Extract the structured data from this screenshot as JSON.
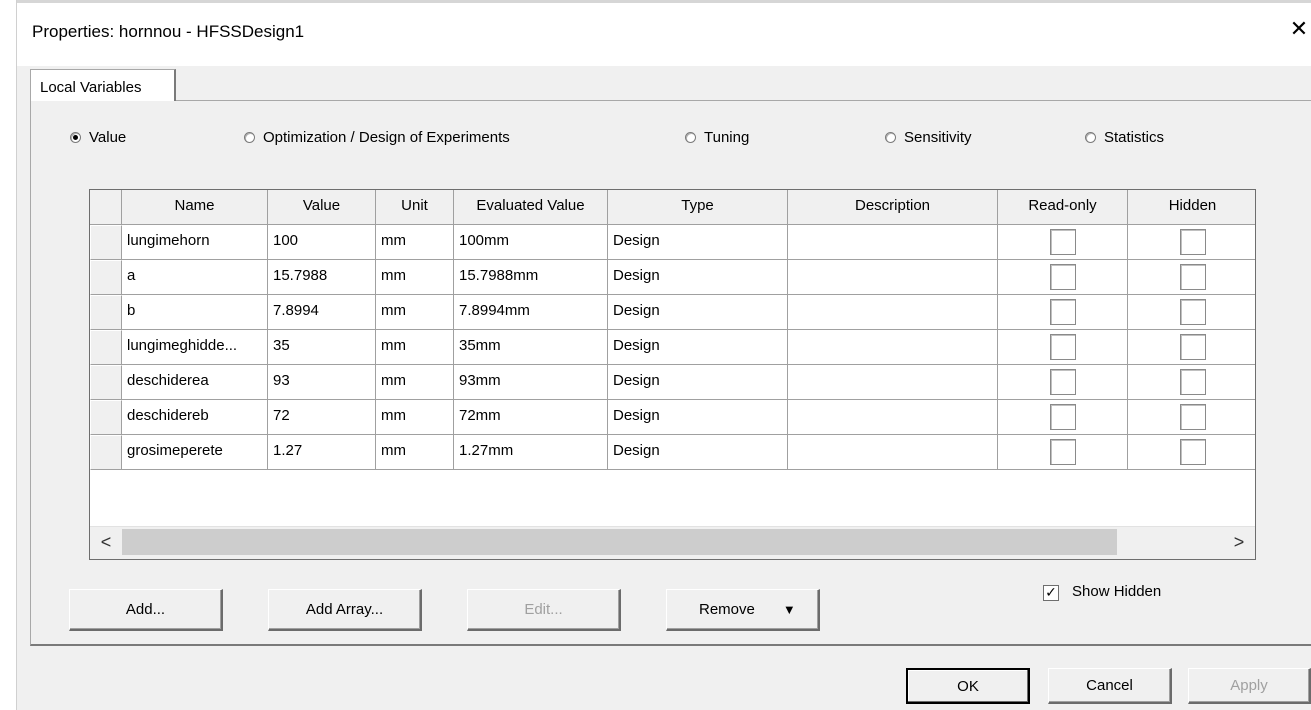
{
  "window": {
    "title": "Properties: hornnou - HFSSDesign1",
    "close_glyph": "✕"
  },
  "tab": {
    "label": "Local Variables"
  },
  "modes": [
    {
      "label": "Value",
      "checked": true
    },
    {
      "label": "Optimization / Design of Experiments",
      "checked": false
    },
    {
      "label": "Tuning",
      "checked": false
    },
    {
      "label": "Sensitivity",
      "checked": false
    },
    {
      "label": "Statistics",
      "checked": false
    }
  ],
  "table": {
    "columns": [
      "Name",
      "Value",
      "Unit",
      "Evaluated Value",
      "Type",
      "Description",
      "Read-only",
      "Hidden"
    ],
    "rows": [
      {
        "name": "lungimehorn",
        "value": "100",
        "unit": "mm",
        "evaluated": "100mm",
        "type": "Design",
        "description": "",
        "read_only": false,
        "hidden": false
      },
      {
        "name": "a",
        "value": "15.7988",
        "unit": "mm",
        "evaluated": "15.7988mm",
        "type": "Design",
        "description": "",
        "read_only": false,
        "hidden": false
      },
      {
        "name": "b",
        "value": "7.8994",
        "unit": "mm",
        "evaluated": "7.8994mm",
        "type": "Design",
        "description": "",
        "read_only": false,
        "hidden": false
      },
      {
        "name": "lungimeghidde...",
        "value": "35",
        "unit": "mm",
        "evaluated": "35mm",
        "type": "Design",
        "description": "",
        "read_only": false,
        "hidden": false
      },
      {
        "name": "deschiderea",
        "value": "93",
        "unit": "mm",
        "evaluated": "93mm",
        "type": "Design",
        "description": "",
        "read_only": false,
        "hidden": false
      },
      {
        "name": "deschidereb",
        "value": "72",
        "unit": "mm",
        "evaluated": "72mm",
        "type": "Design",
        "description": "",
        "read_only": false,
        "hidden": false
      },
      {
        "name": "grosimeperete",
        "value": "1.27",
        "unit": "mm",
        "evaluated": "1.27mm",
        "type": "Design",
        "description": "",
        "read_only": false,
        "hidden": false
      }
    ]
  },
  "scrollbar": {
    "left_glyph": "<",
    "right_glyph": ">"
  },
  "actions": {
    "add": "Add...",
    "add_array": "Add Array...",
    "edit": "Edit...",
    "remove": "Remove",
    "remove_arrow": "▼"
  },
  "show_hidden": {
    "label": "Show Hidden",
    "checked": true,
    "glyph": "✓"
  },
  "footer": {
    "ok": "OK",
    "cancel": "Cancel",
    "apply": "Apply"
  }
}
